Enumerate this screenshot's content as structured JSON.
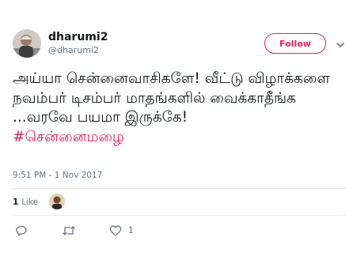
{
  "user": {
    "display_name": "dharumi2",
    "handle": "@dharumi2",
    "avatar_icon": "profile-photo"
  },
  "follow_button": {
    "label": "Follow",
    "color": "#e0245e"
  },
  "tweet": {
    "text": "அய்யா சென்னைவாசிகளே! வீட்டு விழாக்களை நவம்பர் டிசம்பர் மாதங்களில் வைக்காதீங்க ...வரவே பயமா இருக்கே!",
    "hashtag": "#சென்னைமழை",
    "timestamp": "9:51 PM - 1 Nov 2017"
  },
  "stats": {
    "like_count": "1",
    "like_label": "Like"
  },
  "actions": {
    "reply_icon": "reply-icon",
    "retweet_icon": "retweet-icon",
    "like_icon": "heart-icon",
    "like_count": "1"
  }
}
